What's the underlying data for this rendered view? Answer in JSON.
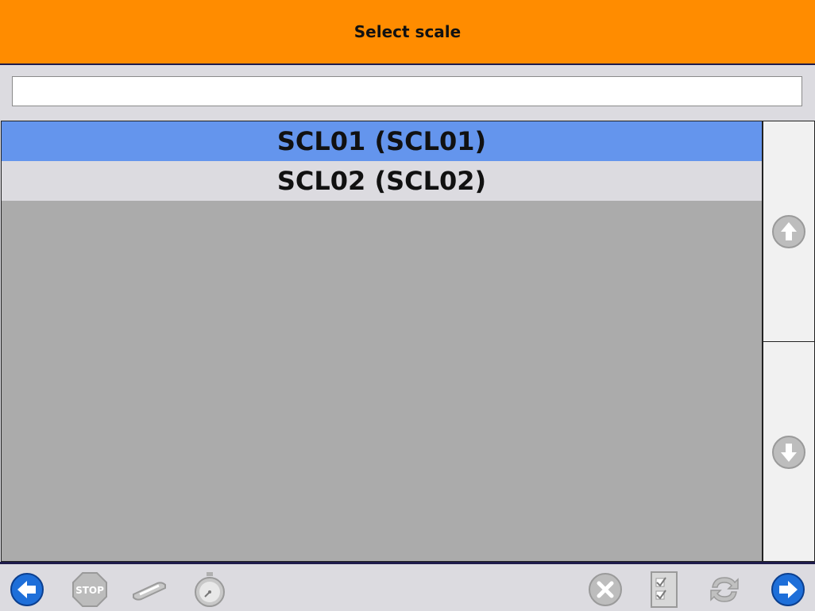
{
  "header": {
    "title": "Select scale"
  },
  "search": {
    "value": "",
    "placeholder": ""
  },
  "list": {
    "items": [
      {
        "label": "SCL01 (SCL01)",
        "selected": true
      },
      {
        "label": "SCL02 (SCL02)",
        "selected": false
      }
    ]
  },
  "scrollbar": {
    "up_icon": "arrow-up-icon",
    "down_icon": "arrow-down-icon"
  },
  "footer": {
    "buttons": [
      {
        "icon": "back-arrow-icon",
        "enabled": true
      },
      {
        "icon": "stop-icon",
        "enabled": false
      },
      {
        "icon": "scanner-icon",
        "enabled": false
      },
      {
        "icon": "stopwatch-icon",
        "enabled": false
      },
      {
        "icon": "cancel-icon",
        "enabled": false
      },
      {
        "icon": "checklist-icon",
        "enabled": false
      },
      {
        "icon": "refresh-icon",
        "enabled": false
      },
      {
        "icon": "forward-arrow-icon",
        "enabled": true
      }
    ]
  },
  "colors": {
    "header": "#ff8c00",
    "selected_row": "#6495ed",
    "list_background": "#ababab",
    "nav_blue": "#1e6fd9"
  }
}
